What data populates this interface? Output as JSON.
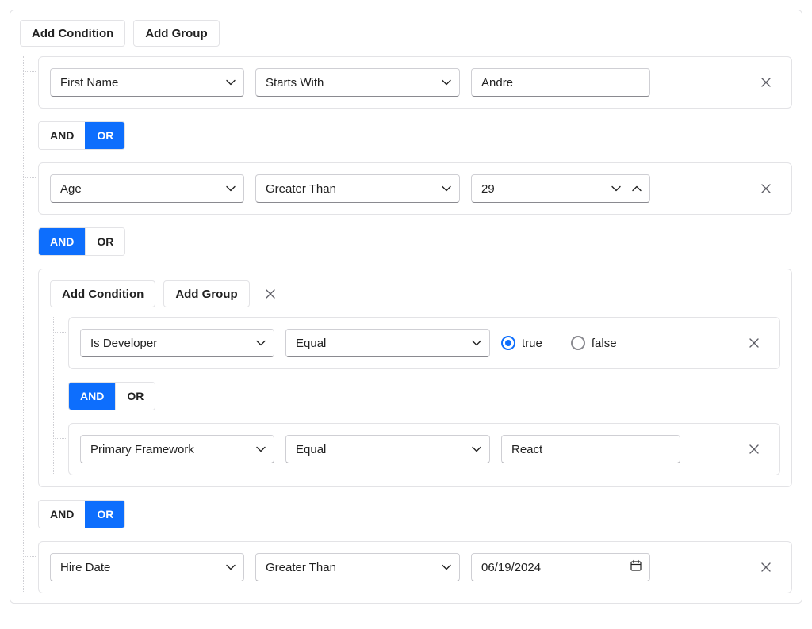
{
  "buttons": {
    "add_condition": "Add Condition",
    "add_group": "Add Group"
  },
  "labels": {
    "and": "AND",
    "or": "OR",
    "true": "true",
    "false": "false"
  },
  "cond1": {
    "field": "First Name",
    "op": "Starts With",
    "value": "Andre"
  },
  "conn1": "OR",
  "cond2": {
    "field": "Age",
    "op": "Greater Than",
    "value": "29"
  },
  "conn2": "AND",
  "group": {
    "cond1": {
      "field": "Is Developer",
      "op": "Equal",
      "value": "true"
    },
    "conn1": "AND",
    "cond2": {
      "field": "Primary Framework",
      "op": "Equal",
      "value": "React"
    }
  },
  "conn3": "OR",
  "cond3": {
    "field": "Hire Date",
    "op": "Greater Than",
    "value": "06/19/2024"
  }
}
